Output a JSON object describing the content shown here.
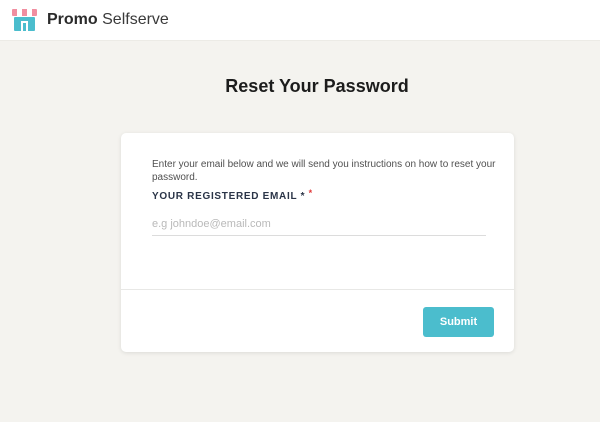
{
  "header": {
    "brand_strong": "Promo",
    "brand_light": "Selfserve",
    "logo_icon": "storefront-awning-icon"
  },
  "page": {
    "title": "Reset Your Password"
  },
  "form": {
    "instructions": "Enter your email below and we will send you instructions on how to reset your password.",
    "email_label": "YOUR REGISTERED EMAIL *",
    "required_marker": "*",
    "email_value": "",
    "email_placeholder": "e.g johndoe@email.com",
    "submit_label": "Submit"
  },
  "colors": {
    "background": "#f4f3ef",
    "submit_button": "#4bbdcd",
    "required_marker": "#e03a3a",
    "label_text": "#2a3447"
  }
}
